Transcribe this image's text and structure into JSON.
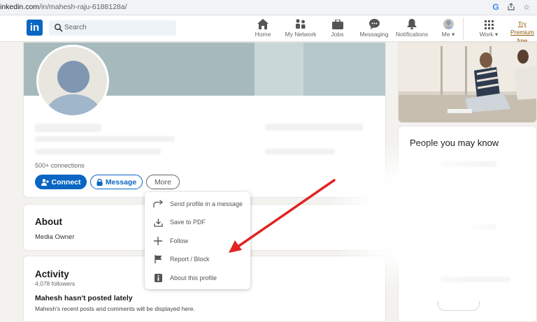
{
  "browser": {
    "url_prefix": "inkedin.com",
    "url_path": "/in/mahesh-raju-6188128a/",
    "icons": [
      "google-icon",
      "share-icon",
      "star-icon"
    ]
  },
  "nav": {
    "logo": "in",
    "search_placeholder": "Search",
    "items": [
      {
        "label": "Home",
        "icon": "home-icon"
      },
      {
        "label": "My Network",
        "icon": "network-icon"
      },
      {
        "label": "Jobs",
        "icon": "jobs-icon"
      },
      {
        "label": "Messaging",
        "icon": "messaging-icon"
      },
      {
        "label": "Notifications",
        "icon": "bell-icon"
      },
      {
        "label": "Me",
        "icon": "avatar"
      },
      {
        "label": "Work",
        "icon": "grid-icon"
      }
    ],
    "premium_line1": "Try Premium",
    "premium_line2": "free"
  },
  "profile": {
    "connections": "500+ connections",
    "connect_label": "Connect",
    "message_label": "Message",
    "more_label": "More"
  },
  "dropdown": {
    "items": [
      {
        "label": "Send profile in a message",
        "icon": "share-arrow-icon"
      },
      {
        "label": "Save to PDF",
        "icon": "download-icon"
      },
      {
        "label": "Follow",
        "icon": "plus-icon"
      },
      {
        "label": "Report / Block",
        "icon": "flag-icon"
      },
      {
        "label": "About this profile",
        "icon": "info-icon"
      }
    ]
  },
  "about": {
    "title": "About",
    "text": "Media Owner"
  },
  "activity": {
    "title": "Activity",
    "followers": "4,078 followers",
    "empty_title": "Mahesh hasn't posted lately",
    "empty_text": "Mahesh's recent posts and comments will be displayed here."
  },
  "sidebar": {
    "people_title": "People you may know"
  },
  "colors": {
    "brand": "#0a66c2",
    "annotation_arrow": "#e02424"
  }
}
